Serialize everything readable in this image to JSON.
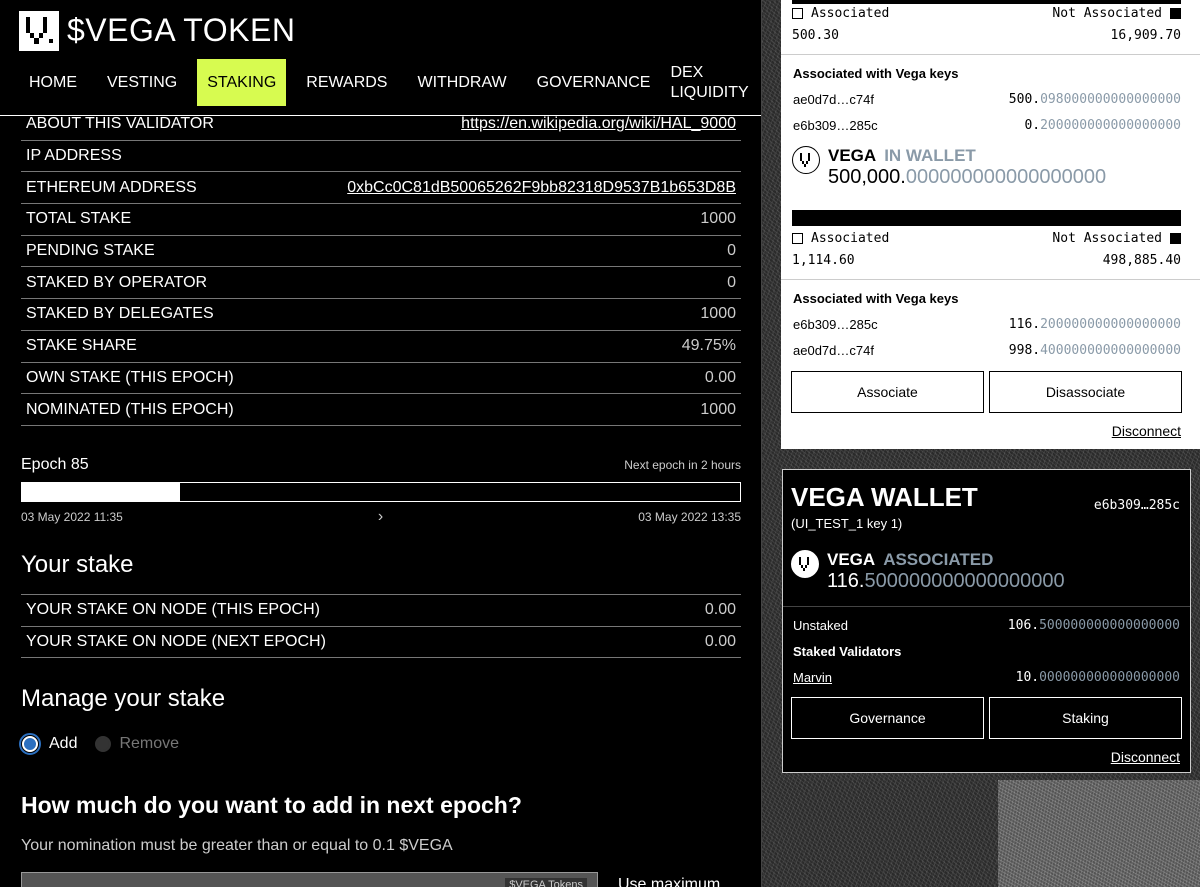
{
  "app": {
    "brand": "$VEGA TOKEN"
  },
  "nav": [
    {
      "label": "HOME"
    },
    {
      "label": "VESTING"
    },
    {
      "label": "STAKING",
      "active": true
    },
    {
      "label": "REWARDS"
    },
    {
      "label": "WITHDRAW"
    },
    {
      "label": "GOVERNANCE"
    },
    {
      "label": "DEX LIQUIDITY"
    }
  ],
  "validator": [
    {
      "k": "ABOUT THIS VALIDATOR",
      "v": "https://en.wikipedia.org/wiki/HAL_9000",
      "link": true
    },
    {
      "k": "IP ADDRESS",
      "v": ""
    },
    {
      "k": "ETHEREUM ADDRESS",
      "v": "0xbCc0C81dB50065262F9bb82318D9537B1b653D8B",
      "link": true
    },
    {
      "k": "TOTAL STAKE",
      "v": "1000"
    },
    {
      "k": "PENDING STAKE",
      "v": "0"
    },
    {
      "k": "STAKED BY OPERATOR",
      "v": "0"
    },
    {
      "k": "STAKED BY DELEGATES",
      "v": "1000"
    },
    {
      "k": "STAKE SHARE",
      "v": "49.75%"
    },
    {
      "k": "OWN STAKE (THIS EPOCH)",
      "v": "0.00"
    },
    {
      "k": "NOMINATED (THIS EPOCH)",
      "v": "1000"
    }
  ],
  "epoch": {
    "title": "Epoch 85",
    "next": "Next epoch in 2 hours",
    "progress": 0.22,
    "start": "03 May 2022 11:35",
    "end": "03 May 2022 13:35",
    "chevron": "›"
  },
  "your_stake": {
    "heading": "Your stake",
    "rows": [
      {
        "k": "YOUR STAKE ON NODE (THIS EPOCH)",
        "v": "0.00"
      },
      {
        "k": "YOUR STAKE ON NODE (NEXT EPOCH)",
        "v": "0.00"
      }
    ]
  },
  "manage": {
    "heading": "Manage your stake",
    "add_label": "Add",
    "remove_label": "Remove",
    "question": "How much do you want to add in next epoch?",
    "hint": "Your nomination must be greater than or equal to 0.1 $VEGA",
    "token_tag": "$VEGA Tokens",
    "use_max": "Use maximum"
  },
  "eth_wallet": {
    "legend_assoc": "Associated",
    "legend_not": "Not Associated",
    "top": {
      "associated": "500.30",
      "not_associated": "16,909.70",
      "keys_heading": "Associated with Vega keys",
      "keys": [
        {
          "key": "ae0d7d…c74f",
          "int": "500.",
          "dec": "098000000000000000"
        },
        {
          "key": "e6b309…285c",
          "int": "0.",
          "dec": "200000000000000000"
        }
      ]
    },
    "vega_token": {
      "name": "VEGA",
      "tag": "IN WALLET",
      "amount_int": "500,000.",
      "amount_dec": "000000000000000000",
      "associated": "1,114.60",
      "not_associated": "498,885.40",
      "keys_heading": "Associated with Vega keys",
      "keys": [
        {
          "key": "e6b309…285c",
          "int": "116.",
          "dec": "200000000000000000"
        },
        {
          "key": "ae0d7d…c74f",
          "int": "998.",
          "dec": "400000000000000000"
        }
      ]
    },
    "associate_label": "Associate",
    "disassociate_label": "Disassociate",
    "disconnect_label": "Disconnect"
  },
  "vega_wallet": {
    "title": "VEGA WALLET",
    "key_short": "e6b309…285c",
    "key_name": "(UI_TEST_1 key 1)",
    "token_name": "VEGA",
    "token_tag": "ASSOCIATED",
    "amount_int": "116.",
    "amount_dec": "500000000000000000",
    "unstaked_label": "Unstaked",
    "unstaked_int": "106.",
    "unstaked_dec": "500000000000000000",
    "staked_heading": "Staked Validators",
    "validator_name": "Marvin",
    "validator_int": "10.",
    "validator_dec": "000000000000000000",
    "governance_label": "Governance",
    "staking_label": "Staking",
    "disconnect_label": "Disconnect"
  },
  "colors": {
    "accent": "#d7fb50",
    "muted_number": "#8a9aa8",
    "radio": "#2b6fbf"
  }
}
